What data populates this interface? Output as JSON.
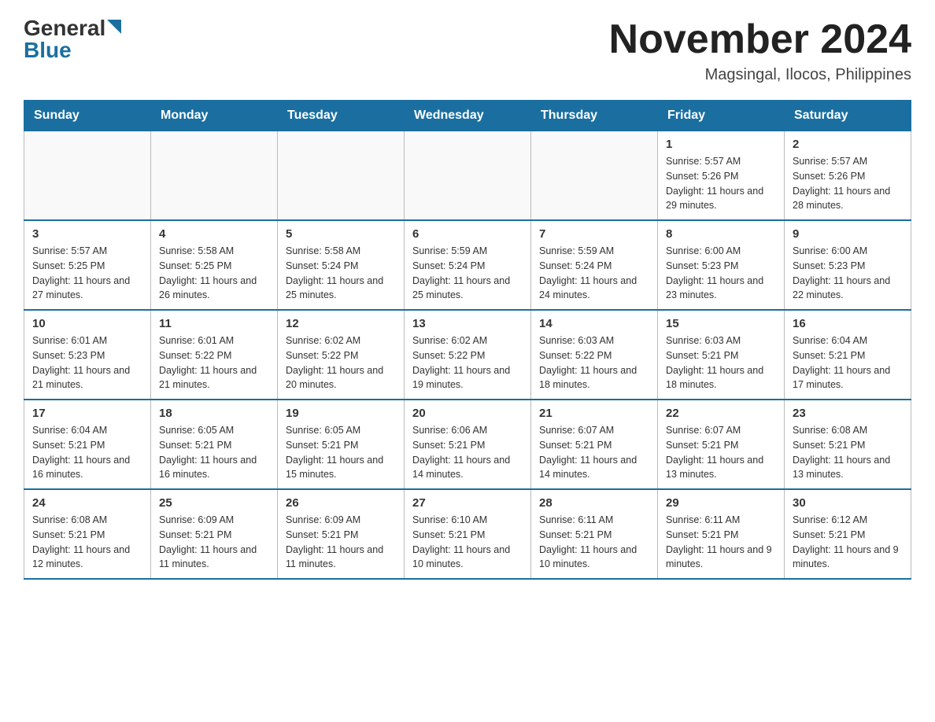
{
  "header": {
    "logo_general": "General",
    "logo_blue": "Blue",
    "month_year": "November 2024",
    "location": "Magsingal, Ilocos, Philippines"
  },
  "weekdays": [
    "Sunday",
    "Monday",
    "Tuesday",
    "Wednesday",
    "Thursday",
    "Friday",
    "Saturday"
  ],
  "weeks": [
    [
      {
        "day": "",
        "sunrise": "",
        "sunset": "",
        "daylight": ""
      },
      {
        "day": "",
        "sunrise": "",
        "sunset": "",
        "daylight": ""
      },
      {
        "day": "",
        "sunrise": "",
        "sunset": "",
        "daylight": ""
      },
      {
        "day": "",
        "sunrise": "",
        "sunset": "",
        "daylight": ""
      },
      {
        "day": "",
        "sunrise": "",
        "sunset": "",
        "daylight": ""
      },
      {
        "day": "1",
        "sunrise": "Sunrise: 5:57 AM",
        "sunset": "Sunset: 5:26 PM",
        "daylight": "Daylight: 11 hours and 29 minutes."
      },
      {
        "day": "2",
        "sunrise": "Sunrise: 5:57 AM",
        "sunset": "Sunset: 5:26 PM",
        "daylight": "Daylight: 11 hours and 28 minutes."
      }
    ],
    [
      {
        "day": "3",
        "sunrise": "Sunrise: 5:57 AM",
        "sunset": "Sunset: 5:25 PM",
        "daylight": "Daylight: 11 hours and 27 minutes."
      },
      {
        "day": "4",
        "sunrise": "Sunrise: 5:58 AM",
        "sunset": "Sunset: 5:25 PM",
        "daylight": "Daylight: 11 hours and 26 minutes."
      },
      {
        "day": "5",
        "sunrise": "Sunrise: 5:58 AM",
        "sunset": "Sunset: 5:24 PM",
        "daylight": "Daylight: 11 hours and 25 minutes."
      },
      {
        "day": "6",
        "sunrise": "Sunrise: 5:59 AM",
        "sunset": "Sunset: 5:24 PM",
        "daylight": "Daylight: 11 hours and 25 minutes."
      },
      {
        "day": "7",
        "sunrise": "Sunrise: 5:59 AM",
        "sunset": "Sunset: 5:24 PM",
        "daylight": "Daylight: 11 hours and 24 minutes."
      },
      {
        "day": "8",
        "sunrise": "Sunrise: 6:00 AM",
        "sunset": "Sunset: 5:23 PM",
        "daylight": "Daylight: 11 hours and 23 minutes."
      },
      {
        "day": "9",
        "sunrise": "Sunrise: 6:00 AM",
        "sunset": "Sunset: 5:23 PM",
        "daylight": "Daylight: 11 hours and 22 minutes."
      }
    ],
    [
      {
        "day": "10",
        "sunrise": "Sunrise: 6:01 AM",
        "sunset": "Sunset: 5:23 PM",
        "daylight": "Daylight: 11 hours and 21 minutes."
      },
      {
        "day": "11",
        "sunrise": "Sunrise: 6:01 AM",
        "sunset": "Sunset: 5:22 PM",
        "daylight": "Daylight: 11 hours and 21 minutes."
      },
      {
        "day": "12",
        "sunrise": "Sunrise: 6:02 AM",
        "sunset": "Sunset: 5:22 PM",
        "daylight": "Daylight: 11 hours and 20 minutes."
      },
      {
        "day": "13",
        "sunrise": "Sunrise: 6:02 AM",
        "sunset": "Sunset: 5:22 PM",
        "daylight": "Daylight: 11 hours and 19 minutes."
      },
      {
        "day": "14",
        "sunrise": "Sunrise: 6:03 AM",
        "sunset": "Sunset: 5:22 PM",
        "daylight": "Daylight: 11 hours and 18 minutes."
      },
      {
        "day": "15",
        "sunrise": "Sunrise: 6:03 AM",
        "sunset": "Sunset: 5:21 PM",
        "daylight": "Daylight: 11 hours and 18 minutes."
      },
      {
        "day": "16",
        "sunrise": "Sunrise: 6:04 AM",
        "sunset": "Sunset: 5:21 PM",
        "daylight": "Daylight: 11 hours and 17 minutes."
      }
    ],
    [
      {
        "day": "17",
        "sunrise": "Sunrise: 6:04 AM",
        "sunset": "Sunset: 5:21 PM",
        "daylight": "Daylight: 11 hours and 16 minutes."
      },
      {
        "day": "18",
        "sunrise": "Sunrise: 6:05 AM",
        "sunset": "Sunset: 5:21 PM",
        "daylight": "Daylight: 11 hours and 16 minutes."
      },
      {
        "day": "19",
        "sunrise": "Sunrise: 6:05 AM",
        "sunset": "Sunset: 5:21 PM",
        "daylight": "Daylight: 11 hours and 15 minutes."
      },
      {
        "day": "20",
        "sunrise": "Sunrise: 6:06 AM",
        "sunset": "Sunset: 5:21 PM",
        "daylight": "Daylight: 11 hours and 14 minutes."
      },
      {
        "day": "21",
        "sunrise": "Sunrise: 6:07 AM",
        "sunset": "Sunset: 5:21 PM",
        "daylight": "Daylight: 11 hours and 14 minutes."
      },
      {
        "day": "22",
        "sunrise": "Sunrise: 6:07 AM",
        "sunset": "Sunset: 5:21 PM",
        "daylight": "Daylight: 11 hours and 13 minutes."
      },
      {
        "day": "23",
        "sunrise": "Sunrise: 6:08 AM",
        "sunset": "Sunset: 5:21 PM",
        "daylight": "Daylight: 11 hours and 13 minutes."
      }
    ],
    [
      {
        "day": "24",
        "sunrise": "Sunrise: 6:08 AM",
        "sunset": "Sunset: 5:21 PM",
        "daylight": "Daylight: 11 hours and 12 minutes."
      },
      {
        "day": "25",
        "sunrise": "Sunrise: 6:09 AM",
        "sunset": "Sunset: 5:21 PM",
        "daylight": "Daylight: 11 hours and 11 minutes."
      },
      {
        "day": "26",
        "sunrise": "Sunrise: 6:09 AM",
        "sunset": "Sunset: 5:21 PM",
        "daylight": "Daylight: 11 hours and 11 minutes."
      },
      {
        "day": "27",
        "sunrise": "Sunrise: 6:10 AM",
        "sunset": "Sunset: 5:21 PM",
        "daylight": "Daylight: 11 hours and 10 minutes."
      },
      {
        "day": "28",
        "sunrise": "Sunrise: 6:11 AM",
        "sunset": "Sunset: 5:21 PM",
        "daylight": "Daylight: 11 hours and 10 minutes."
      },
      {
        "day": "29",
        "sunrise": "Sunrise: 6:11 AM",
        "sunset": "Sunset: 5:21 PM",
        "daylight": "Daylight: 11 hours and 9 minutes."
      },
      {
        "day": "30",
        "sunrise": "Sunrise: 6:12 AM",
        "sunset": "Sunset: 5:21 PM",
        "daylight": "Daylight: 11 hours and 9 minutes."
      }
    ]
  ]
}
